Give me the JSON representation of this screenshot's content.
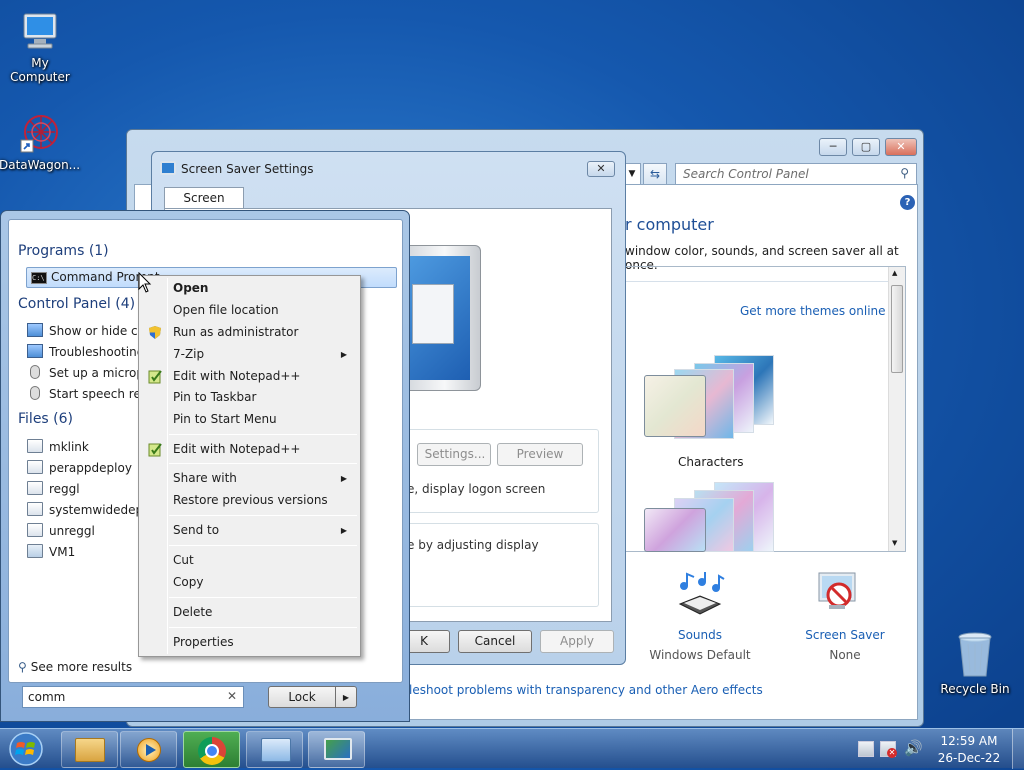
{
  "desktop": {
    "icons": [
      {
        "label": "My Computer",
        "icon": "computer-icon"
      },
      {
        "label": "DataWagon...",
        "icon": "datawagon-shortcut-icon"
      },
      {
        "label": "Recycle Bin",
        "icon": "recycle-bin-icon"
      }
    ]
  },
  "control_panel": {
    "search_placeholder": "Search Control Panel",
    "heading": "r computer",
    "description": "window color, sounds, and screen saver all at once.",
    "get_more_themes": "Get more themes online",
    "theme_name": "Characters",
    "sounds_label": "Sounds",
    "sounds_value": "Windows Default",
    "screen_saver_label": "Screen Saver",
    "screen_saver_value": "None",
    "troubleshoot_link": "leshoot problems with transparency and other Aero effects"
  },
  "screen_saver_dialog": {
    "title": "Screen Saver Settings",
    "tab": "Screen Saver",
    "settings_btn": "Settings...",
    "preview_btn": "Preview",
    "logon_text": "e, display logon screen",
    "power_text": "e by adjusting display",
    "ok_btn": "K",
    "cancel_btn": "Cancel",
    "apply_btn": "Apply"
  },
  "start_menu": {
    "programs_header": "Programs (1)",
    "program_item": "Command Prompt",
    "control_panel_header": "Control Panel (4)",
    "control_panel_items": [
      "Show or hide cor",
      "Troubleshooting",
      "Set up a microph",
      "Start speech reco"
    ],
    "files_header": "Files (6)",
    "file_items": [
      "mklink",
      "perappdeploy",
      "reggl",
      "systemwidedeplo",
      "unreggl",
      "VM1"
    ],
    "see_more": "See more results",
    "search_value": "comm",
    "lock_btn": "Lock"
  },
  "context_menu": {
    "items": [
      "Open",
      "Open file location",
      "Run as administrator",
      "7-Zip",
      "Edit with Notepad++",
      "Pin to Taskbar",
      "Pin to Start Menu",
      "Edit with Notepad++",
      "Share with",
      "Restore previous versions",
      "Send to",
      "Cut",
      "Copy",
      "Delete",
      "Properties"
    ]
  },
  "taskbar": {
    "time": "12:59 AM",
    "date": "26-Dec-22"
  }
}
